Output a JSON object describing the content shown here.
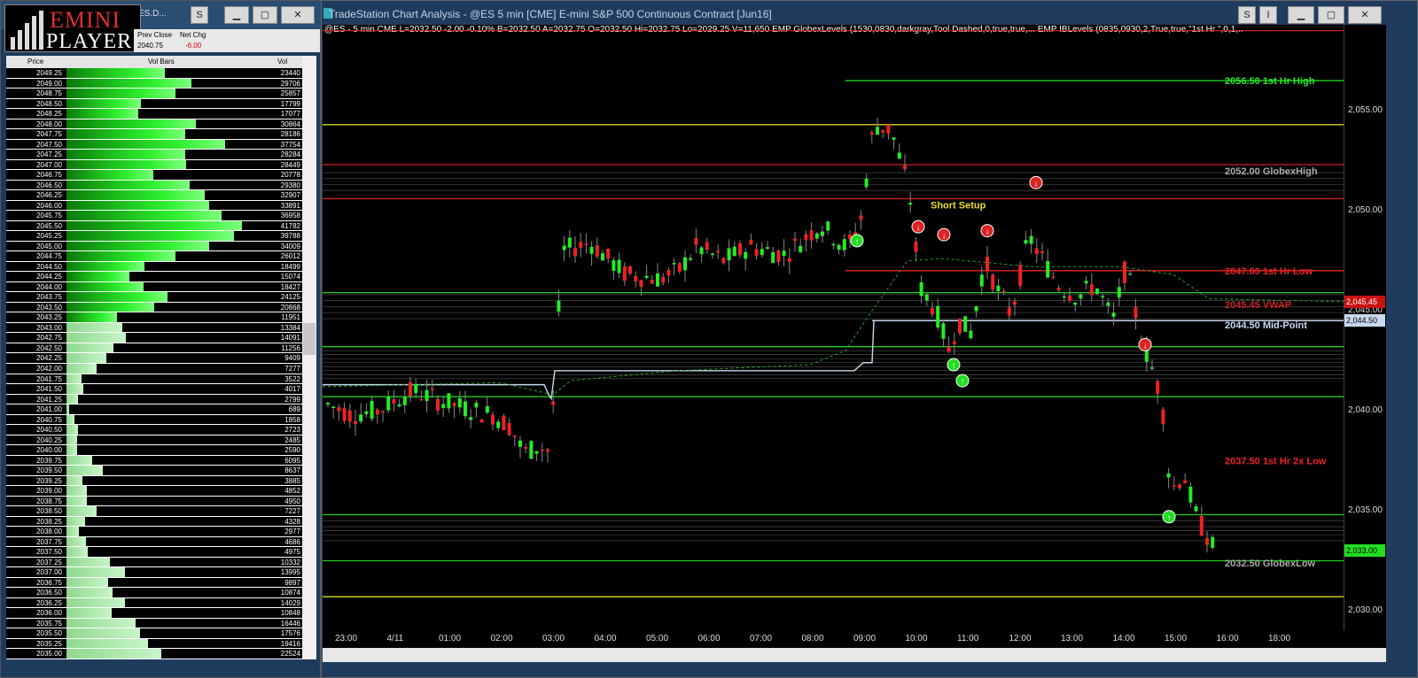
{
  "left_window": {
    "logo_top": "EMINI",
    "logo_bottom": "PLAYER",
    "symbol": "ES.D...",
    "hdr_prev_close_label": "Prev Close",
    "hdr_net_chg_label": "Net Chg",
    "prev_close": "2040.75",
    "net_chg": "-6.00",
    "col_price": "Price",
    "col_volbars": "Vol Bars",
    "col_vol": "Vol",
    "rows": [
      [
        "2049.25",
        "23440"
      ],
      [
        "2049.00",
        "29706"
      ],
      [
        "2048.75",
        "25857"
      ],
      [
        "2048.50",
        "17799"
      ],
      [
        "2048.25",
        "17077"
      ],
      [
        "2048.00",
        "30864"
      ],
      [
        "2047.75",
        "28186"
      ],
      [
        "2047.50",
        "37754"
      ],
      [
        "2047.25",
        "28284"
      ],
      [
        "2047.00",
        "28449"
      ],
      [
        "2046.75",
        "20778"
      ],
      [
        "2046.50",
        "29380"
      ],
      [
        "2046.25",
        "32907"
      ],
      [
        "2046.00",
        "33891"
      ],
      [
        "2045.75",
        "36958"
      ],
      [
        "2045.50",
        "41782"
      ],
      [
        "2045.25",
        "39788"
      ],
      [
        "2045.00",
        "34009"
      ],
      [
        "2044.75",
        "26012"
      ],
      [
        "2044.50",
        "18499"
      ],
      [
        "2044.25",
        "15074"
      ],
      [
        "2044.00",
        "18427"
      ],
      [
        "2043.75",
        "24125"
      ],
      [
        "2043.50",
        "20868"
      ],
      [
        "2043.25",
        "11951"
      ],
      [
        "2043.00",
        "13384"
      ],
      [
        "2042.75",
        "14091"
      ],
      [
        "2042.50",
        "11256"
      ],
      [
        "2042.25",
        "9409"
      ],
      [
        "2042.00",
        "7277"
      ],
      [
        "2041.75",
        "3522"
      ],
      [
        "2041.50",
        "4017"
      ],
      [
        "2041.25",
        "2799"
      ],
      [
        "2041.00",
        "689"
      ],
      [
        "2040.75",
        "1858"
      ],
      [
        "2040.50",
        "2723"
      ],
      [
        "2040.25",
        "2485"
      ],
      [
        "2040.00",
        "2590"
      ],
      [
        "2039.75",
        "6095"
      ],
      [
        "2039.50",
        "8637"
      ],
      [
        "2039.25",
        "3885"
      ],
      [
        "2039.00",
        "4852"
      ],
      [
        "2038.75",
        "4950"
      ],
      [
        "2038.50",
        "7227"
      ],
      [
        "2038.25",
        "4328"
      ],
      [
        "2038.00",
        "2977"
      ],
      [
        "2037.75",
        "4686"
      ],
      [
        "2037.50",
        "4975"
      ],
      [
        "2037.25",
        "10332"
      ],
      [
        "2037.00",
        "13995"
      ],
      [
        "2036.75",
        "9897"
      ],
      [
        "2036.50",
        "10874"
      ],
      [
        "2036.25",
        "14029"
      ],
      [
        "2036.00",
        "10848"
      ],
      [
        "2035.75",
        "16446"
      ],
      [
        "2035.50",
        "17576"
      ],
      [
        "2035.25",
        "19416"
      ],
      [
        "2035.00",
        "22524"
      ]
    ]
  },
  "chart_window": {
    "title": "TradeStation Chart Analysis - @ES 5 min [CME] E-mini S&P 500 Continuous Contract [Jun16]",
    "status_line": "@ES - 5 min  CME  L=2032.50  -2.00  -0.10%  B=2032.50  A=2032.75  O=2032.50  Hi=2032.75  Lo=2029.25  V=11,650  EMP  GlobexLevels (1530,0830,darkgray,Tool  Dashed,0,true,true,...   EMP  IBLevels (0835,0930,2,True,true,\"1st Hr \",0,1,..",
    "annotation_short_setup": "Short Setup",
    "price_ticks": [
      "2,055.00",
      "2,050.00",
      "2,045.00",
      "2,040.00",
      "2,035.00",
      "2,030.00"
    ],
    "price_badges": {
      "vwap": "2,045.45",
      "mid": "2,044.50",
      "last": "2,033.00"
    },
    "time_ticks": [
      "23:00",
      "4/11",
      "01:00",
      "02:00",
      "03:00",
      "04:00",
      "05:00",
      "06:00",
      "07:00",
      "08:00",
      "09:00",
      "10:00",
      "11:00",
      "12:00",
      "13:00",
      "14:00",
      "15:00",
      "16:00",
      "18:00"
    ],
    "levels": [
      {
        "price": 2056.5,
        "label": "2056.50 1st Hr  High",
        "color": "#22ee22"
      },
      {
        "price": 2052.0,
        "label": "2052.00 GlobexHigh",
        "color": "#aaaaaa"
      },
      {
        "price": 2047.0,
        "label": "2047.00 1st Hr  Low",
        "color": "#ee2222"
      },
      {
        "price": 2045.45,
        "label": "2045.45 VWAP",
        "color": "#cc2222"
      },
      {
        "price": 2044.5,
        "label": "2044.50 Mid-Point",
        "color": "#c8d8f0"
      },
      {
        "price": 2037.5,
        "label": "2037.50 1st Hr  2x Low",
        "color": "#ee2222"
      },
      {
        "price": 2032.5,
        "label": "2032.50 GlobexLow",
        "color": "#aaaaaa"
      }
    ]
  },
  "colors": {
    "bull": "#22ee22",
    "bear": "#ee2222",
    "bg": "#000000",
    "window": "#1f3c5f"
  }
}
